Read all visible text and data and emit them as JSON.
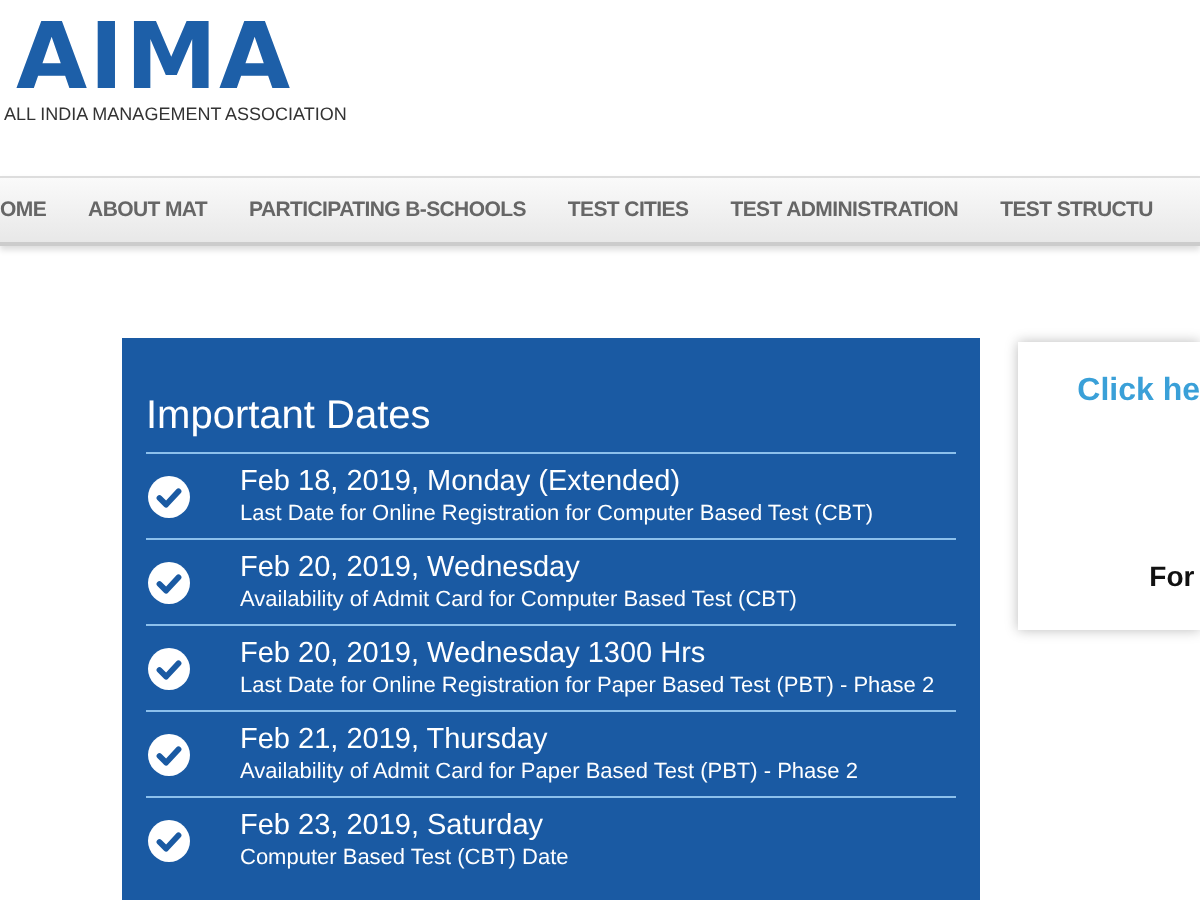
{
  "logo": {
    "title": "AIMA",
    "subtitle": "ALL INDIA MANAGEMENT ASSOCIATION"
  },
  "nav": [
    {
      "label": "OME"
    },
    {
      "label": "ABOUT MAT"
    },
    {
      "label": "PARTICIPATING B-SCHOOLS"
    },
    {
      "label": "TEST CITIES"
    },
    {
      "label": "TEST ADMINISTRATION"
    },
    {
      "label": "TEST STRUCTU"
    }
  ],
  "important_dates": {
    "title": "Important Dates",
    "items": [
      {
        "date": "Feb 18, 2019, Monday (Extended)",
        "description": "Last Date for Online Registration for Computer Based Test (CBT)"
      },
      {
        "date": "Feb 20, 2019, Wednesday",
        "description": "Availability of Admit Card for Computer Based Test (CBT)"
      },
      {
        "date": "Feb 20, 2019, Wednesday 1300 Hrs",
        "description": "Last Date for Online Registration for Paper Based Test (PBT) - Phase 2"
      },
      {
        "date": "Feb 21, 2019, Thursday",
        "description": "Availability of Admit Card for Paper Based Test (PBT) - Phase 2"
      },
      {
        "date": "Feb 23, 2019, Saturday",
        "description": "Computer Based Test (CBT) Date"
      }
    ]
  },
  "side_card": {
    "link": "Click he",
    "text": "For"
  }
}
